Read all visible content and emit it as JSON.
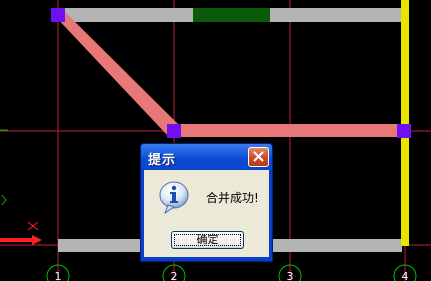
{
  "dialog": {
    "title": "提示",
    "message": "合并成功!",
    "ok_label": "确定",
    "icon": "info-icon",
    "close_icon": "close-icon"
  },
  "drawing": {
    "axis_labels": [
      "1",
      "2",
      "3",
      "4"
    ],
    "colors": {
      "background": "#000000",
      "grid_line": "#c0203a",
      "beam_gray": "#b4b4b4",
      "beam_green": "#0a5a0a",
      "brace_pink": "#e87878",
      "node_purple": "#7010f0",
      "column_yellow": "#e6e600",
      "ucs_red": "#ff2020",
      "ucs_green": "#00c000"
    }
  }
}
